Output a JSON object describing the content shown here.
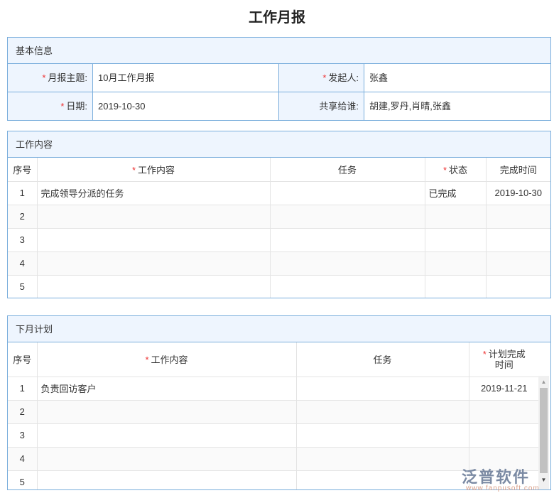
{
  "title": "工作月报",
  "basic": {
    "header": "基本信息",
    "fields": [
      {
        "label": "月报主题:",
        "required": true,
        "value": "10月工作月报"
      },
      {
        "label": "发起人:",
        "required": true,
        "value": "张鑫"
      },
      {
        "label": "日期:",
        "required": true,
        "value": "2019-10-30"
      },
      {
        "label": "共享给谁:",
        "required": false,
        "value": "胡建,罗丹,肖晴,张鑫"
      }
    ]
  },
  "work": {
    "header": "工作内容",
    "columns": [
      "序号",
      "工作内容",
      "任务",
      "状态",
      "完成时间"
    ],
    "rows": [
      [
        "1",
        "完成领导分派的任务",
        "",
        "已完成",
        "2019-10-30"
      ],
      [
        "2",
        "",
        "",
        "",
        ""
      ],
      [
        "3",
        "",
        "",
        "",
        ""
      ],
      [
        "4",
        "",
        "",
        "",
        ""
      ],
      [
        "5",
        "",
        "",
        "",
        ""
      ]
    ]
  },
  "plan": {
    "header": "下月计划",
    "columns": [
      "序号",
      "工作内容",
      "任务",
      "计划完成时间"
    ],
    "rows": [
      [
        "1",
        "负责回访客户",
        "",
        "2019-11-21"
      ],
      [
        "2",
        "",
        "",
        ""
      ],
      [
        "3",
        "",
        "",
        ""
      ],
      [
        "4",
        "",
        "",
        ""
      ],
      [
        "5",
        "",
        "",
        ""
      ]
    ]
  },
  "watermark": {
    "brand": "泛普软件",
    "url": "www.fanpusoft.com"
  }
}
